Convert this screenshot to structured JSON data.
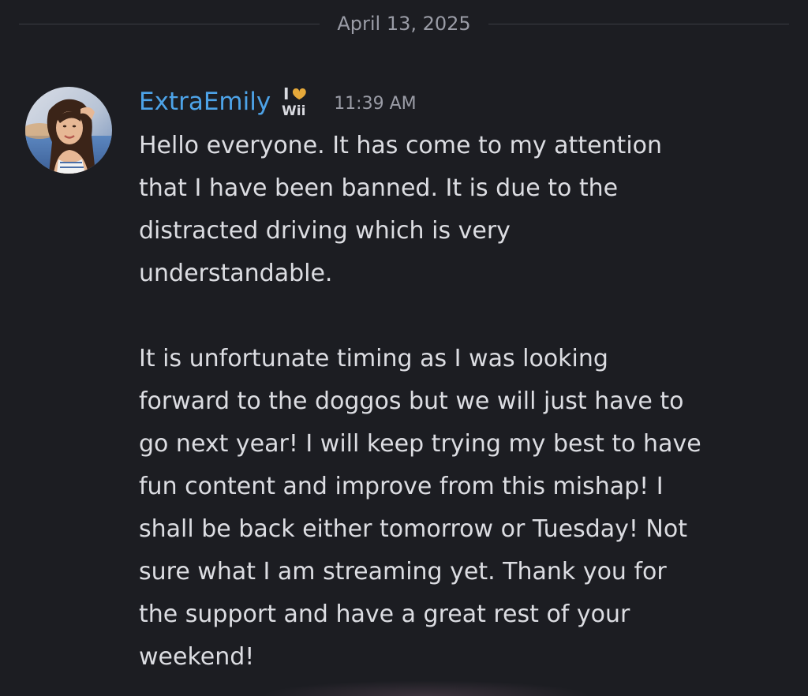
{
  "date_divider": {
    "label": "April 13, 2025"
  },
  "message": {
    "username": "ExtraEmily",
    "username_color": "#4da3e8",
    "badge": {
      "icon": "i-heart-wii-icon",
      "top_text": "I",
      "bottom_text": "Wii"
    },
    "timestamp": "11:39 AM",
    "paragraphs": [
      {
        "lines": [
          "Hello everyone. It has come to my attention",
          "that I have been banned. It is due to the",
          "distracted driving which is very",
          "understandable."
        ]
      },
      {
        "lines": [
          "It is unfortunate timing as I was looking",
          "forward to the doggos but we will just have to",
          "go next year! I will keep trying my best to have",
          "fun content and improve from this mishap! I",
          "shall be back either tomorrow or Tuesday! Not",
          "sure what I am streaming yet. Thank you for",
          "the support and have a great rest of your",
          "weekend!"
        ]
      }
    ]
  },
  "colors": {
    "background": "#1c1d22",
    "text": "#dcdde2",
    "muted": "#9a9ca6",
    "badge_gold": "#e6a93a"
  }
}
